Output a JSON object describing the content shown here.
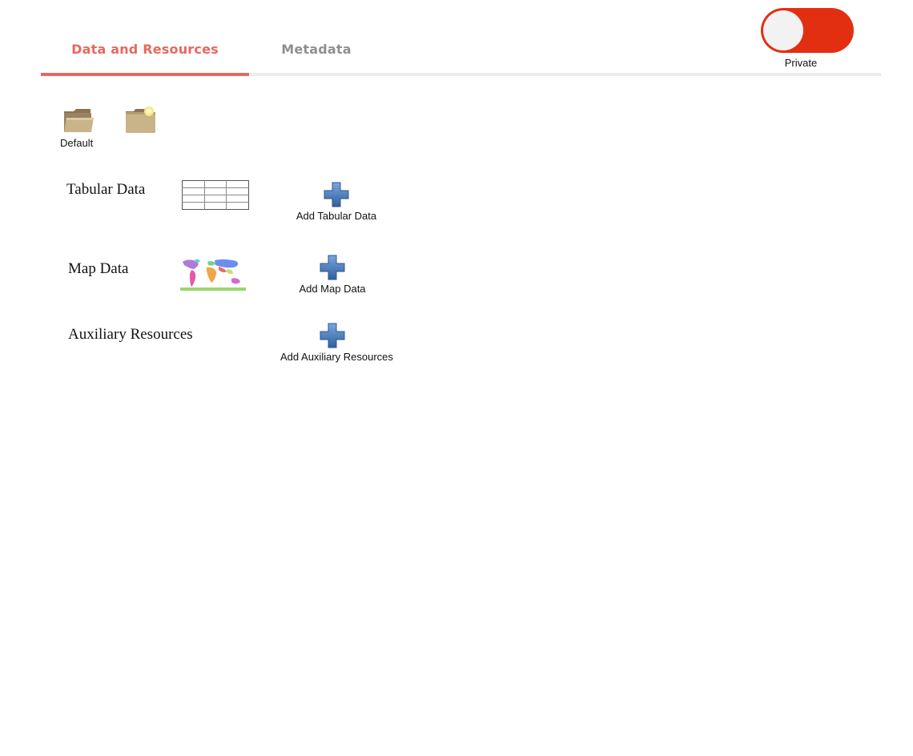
{
  "tabs": [
    {
      "label": "Data and Resources",
      "active": true
    },
    {
      "label": "Metadata",
      "active": false
    }
  ],
  "visibility_toggle": {
    "label": "Private",
    "state": "private",
    "color": "#e22f12"
  },
  "folders": {
    "default_label": "Default",
    "icons": [
      "open-folder-icon",
      "new-folder-icon"
    ]
  },
  "sections": [
    {
      "title": "Tabular Data",
      "thumbnail": "table-grid-icon",
      "add_label": "Add Tabular Data"
    },
    {
      "title": "Map Data",
      "thumbnail": "world-map-icon",
      "add_label": "Add Map Data"
    },
    {
      "title": "Auxiliary Resources",
      "add_label": "Add Auxiliary Resources"
    }
  ],
  "colors": {
    "accent": "#e8685f",
    "tab_inactive": "#8f8f8f",
    "toggle_on": "#e22f12",
    "plus_blue": "#3f72b8"
  }
}
